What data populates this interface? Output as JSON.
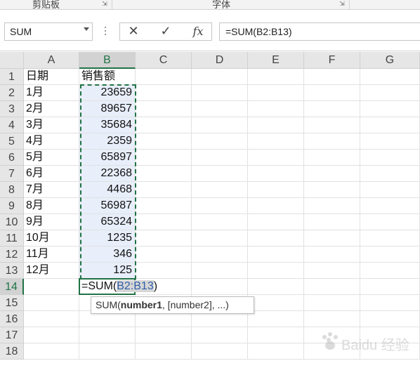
{
  "ribbon": {
    "clipboard_label": "剪贴板",
    "font_label": "字体"
  },
  "formula_bar": {
    "name_box": "SUM",
    "cancel_symbol": "✕",
    "enter_symbol": "✓",
    "fx_label": "fx",
    "formula": "=SUM(B2:B13)"
  },
  "columns": [
    "A",
    "B",
    "C",
    "D",
    "E",
    "F",
    "G"
  ],
  "rows": [
    "1",
    "2",
    "3",
    "4",
    "5",
    "6",
    "7",
    "8",
    "9",
    "10",
    "11",
    "12",
    "13",
    "14",
    "15",
    "16",
    "17",
    "18"
  ],
  "sheet": {
    "header": {
      "a": "日期",
      "b": "销售额"
    },
    "data": [
      {
        "month": "1月",
        "sales": "23659"
      },
      {
        "month": "2月",
        "sales": "89657"
      },
      {
        "month": "3月",
        "sales": "35684"
      },
      {
        "month": "4月",
        "sales": "2359"
      },
      {
        "month": "5月",
        "sales": "65897"
      },
      {
        "month": "6月",
        "sales": "22368"
      },
      {
        "month": "7月",
        "sales": "4468"
      },
      {
        "month": "8月",
        "sales": "56987"
      },
      {
        "month": "9月",
        "sales": "65324"
      },
      {
        "month": "10月",
        "sales": "1235"
      },
      {
        "month": "11月",
        "sales": "346"
      },
      {
        "month": "12月",
        "sales": "125"
      }
    ],
    "active_formula_prefix": "=SUM(",
    "active_formula_ref": "B2:B13",
    "active_formula_suffix": ")"
  },
  "tooltip": {
    "fn": "SUM(",
    "arg1": "number1",
    "rest": ", [number2], ...)"
  },
  "colors": {
    "accent": "#217346",
    "highlight": "#e8eefa",
    "ref_text": "#2f5fa8"
  },
  "watermark": {
    "text": "Baidu 经验"
  }
}
